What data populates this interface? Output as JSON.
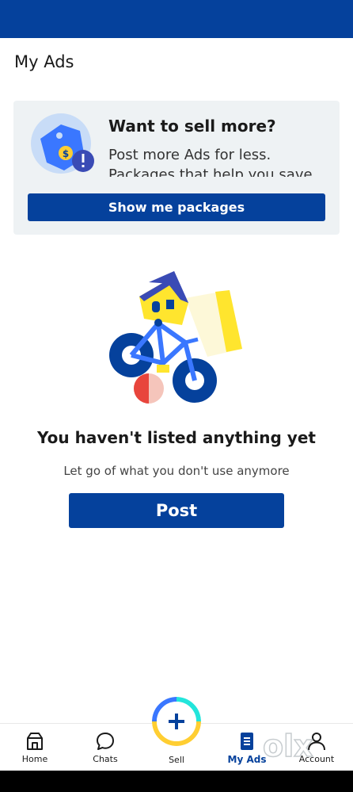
{
  "header": {
    "title": "My Ads"
  },
  "promo": {
    "heading": "Want to sell more?",
    "text": "Post more Ads for less. Packages that help you save",
    "button_label": "Show me packages"
  },
  "empty_state": {
    "title": "You haven't listed anything yet",
    "subtitle": "Let go of what you don't use anymore",
    "button_label": "Post"
  },
  "bottom_nav": {
    "items": [
      {
        "label": "Home",
        "icon": "home-icon"
      },
      {
        "label": "Chats",
        "icon": "chat-icon"
      },
      {
        "label": "Sell",
        "icon": "plus-icon"
      },
      {
        "label": "My Ads",
        "icon": "document-icon",
        "active": true
      },
      {
        "label": "Account",
        "icon": "person-icon"
      }
    ]
  },
  "watermark": {
    "text": "olx"
  },
  "colors": {
    "brand_blue": "#05419c",
    "accent_yellow": "#ffce32",
    "accent_teal": "#23e5db",
    "card_bg": "#eef2f4"
  }
}
